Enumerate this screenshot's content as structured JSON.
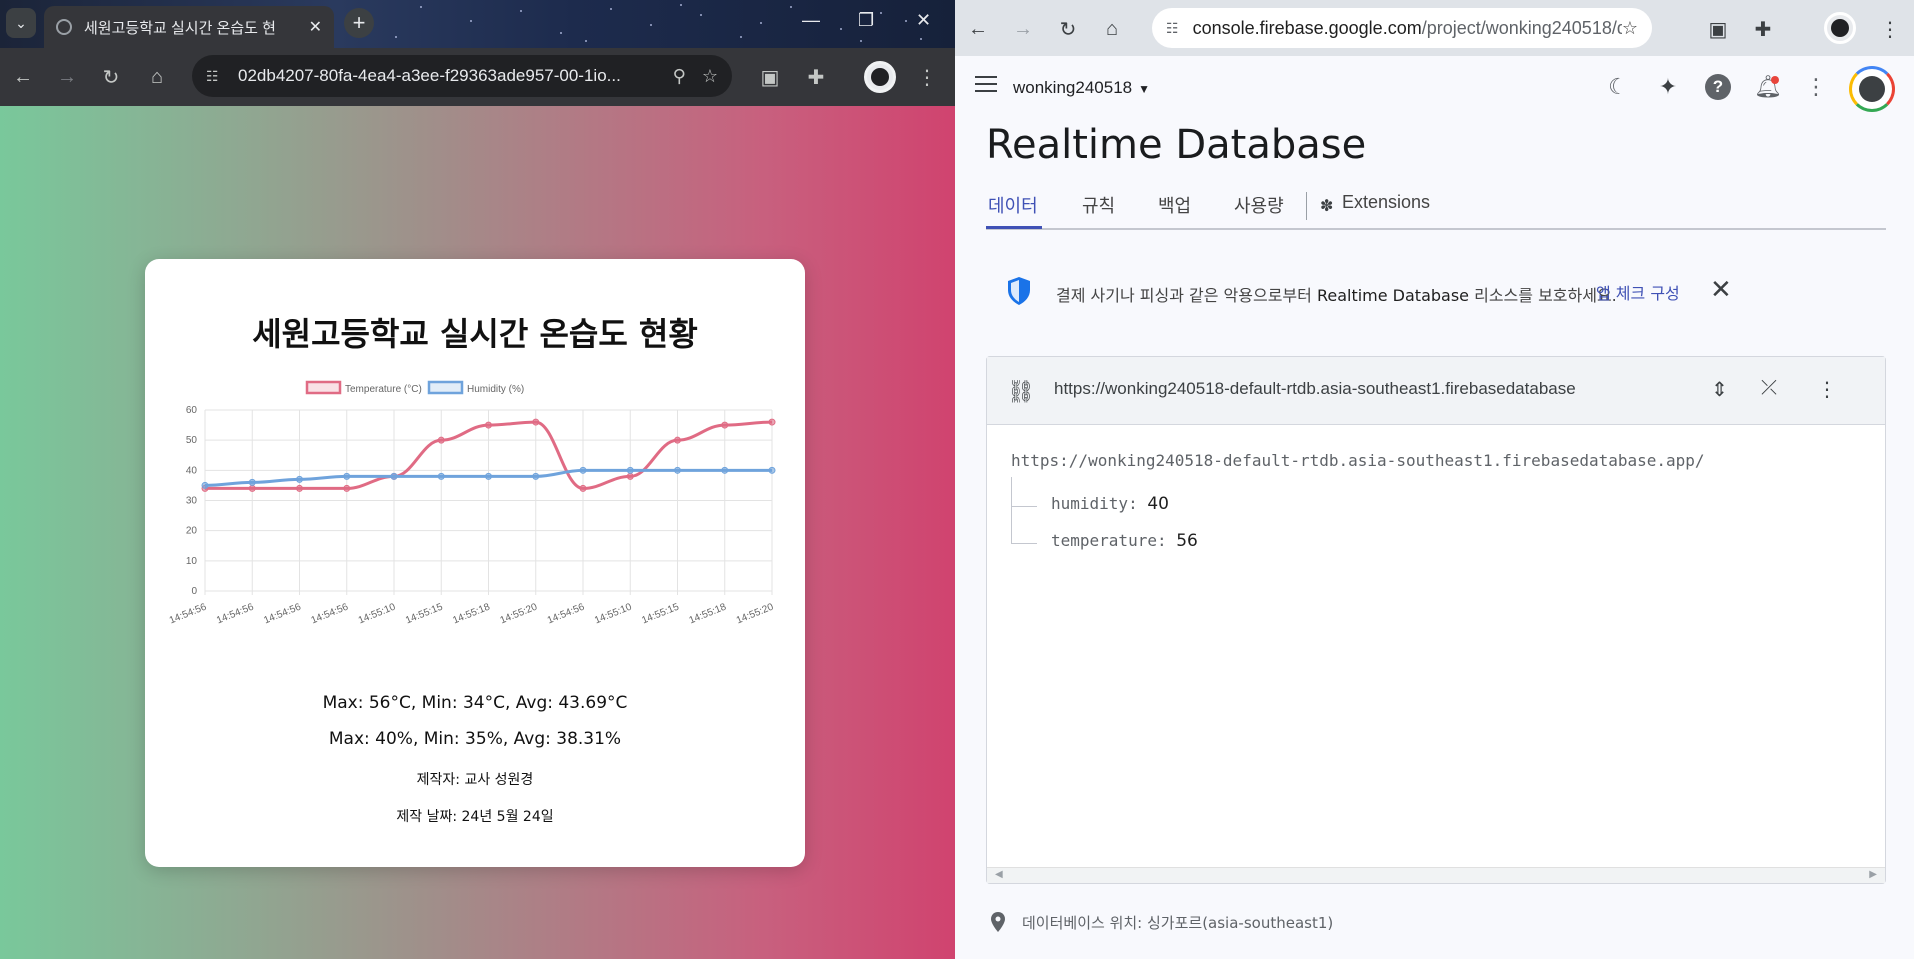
{
  "left_window": {
    "tab_title": "세원고등학교 실시간 온습도 현",
    "address": "02db4207-80fa-4ea4-a3ee-f29363ade957-00-1io...",
    "card": {
      "title": "세원고등학교 실시간 온습도 현황",
      "temp_stats": "Max: 56°C, Min: 34°C, Avg: 43.69°C",
      "humidity_stats": "Max: 40%, Min: 35%, Avg: 38.31%",
      "author": "제작자: 교사 성원경",
      "date": "제작 날짜: 24년 5월 24일"
    }
  },
  "chart_data": {
    "type": "line",
    "categories": [
      "14:54:56",
      "14:54:56",
      "14:54:56",
      "14:54:56",
      "14:55:10",
      "14:55:15",
      "14:55:18",
      "14:55:20",
      "14:54:56",
      "14:55:10",
      "14:55:15",
      "14:55:18",
      "14:55:20"
    ],
    "series": [
      {
        "name": "Temperature (°C)",
        "color": "#e06b84",
        "values": [
          34,
          34,
          34,
          34,
          38,
          50,
          55,
          56,
          34,
          38,
          50,
          55,
          56
        ]
      },
      {
        "name": "Humidity (%)",
        "color": "#6fa3dc",
        "values": [
          35,
          36,
          37,
          38,
          38,
          38,
          38,
          38,
          40,
          40,
          40,
          40,
          40
        ]
      }
    ],
    "ylim": [
      0,
      60
    ],
    "yticks": [
      0,
      10,
      20,
      30,
      40,
      50,
      60
    ],
    "legend": "top",
    "grid": true
  },
  "right_window": {
    "address_host": "console.firebase.google.com",
    "address_path": "/project/wonking240518/d...",
    "project_name": "wonking240518",
    "page_title": "Realtime Database",
    "tabs": [
      "데이터",
      "규칙",
      "백업",
      "사용량"
    ],
    "extensions_label": "Extensions",
    "banner": {
      "text_before": "결제 사기나 피싱과 같은 악용으로부터 ",
      "text_bold": "Realtime Database",
      "text_after": " 리소스를 보호하세요.",
      "link": "앱 체크 구성"
    },
    "db": {
      "header_url": "https://wonking240518-default-rtdb.asia-southeast1.firebasedatabase",
      "root_url": "https://wonking240518-default-rtdb.asia-southeast1.firebasedatabase.app/",
      "nodes": [
        {
          "key": "humidity",
          "value": "40"
        },
        {
          "key": "temperature",
          "value": "56"
        }
      ]
    },
    "location": "데이터베이스 위치: 싱가포르(asia-southeast1)"
  }
}
